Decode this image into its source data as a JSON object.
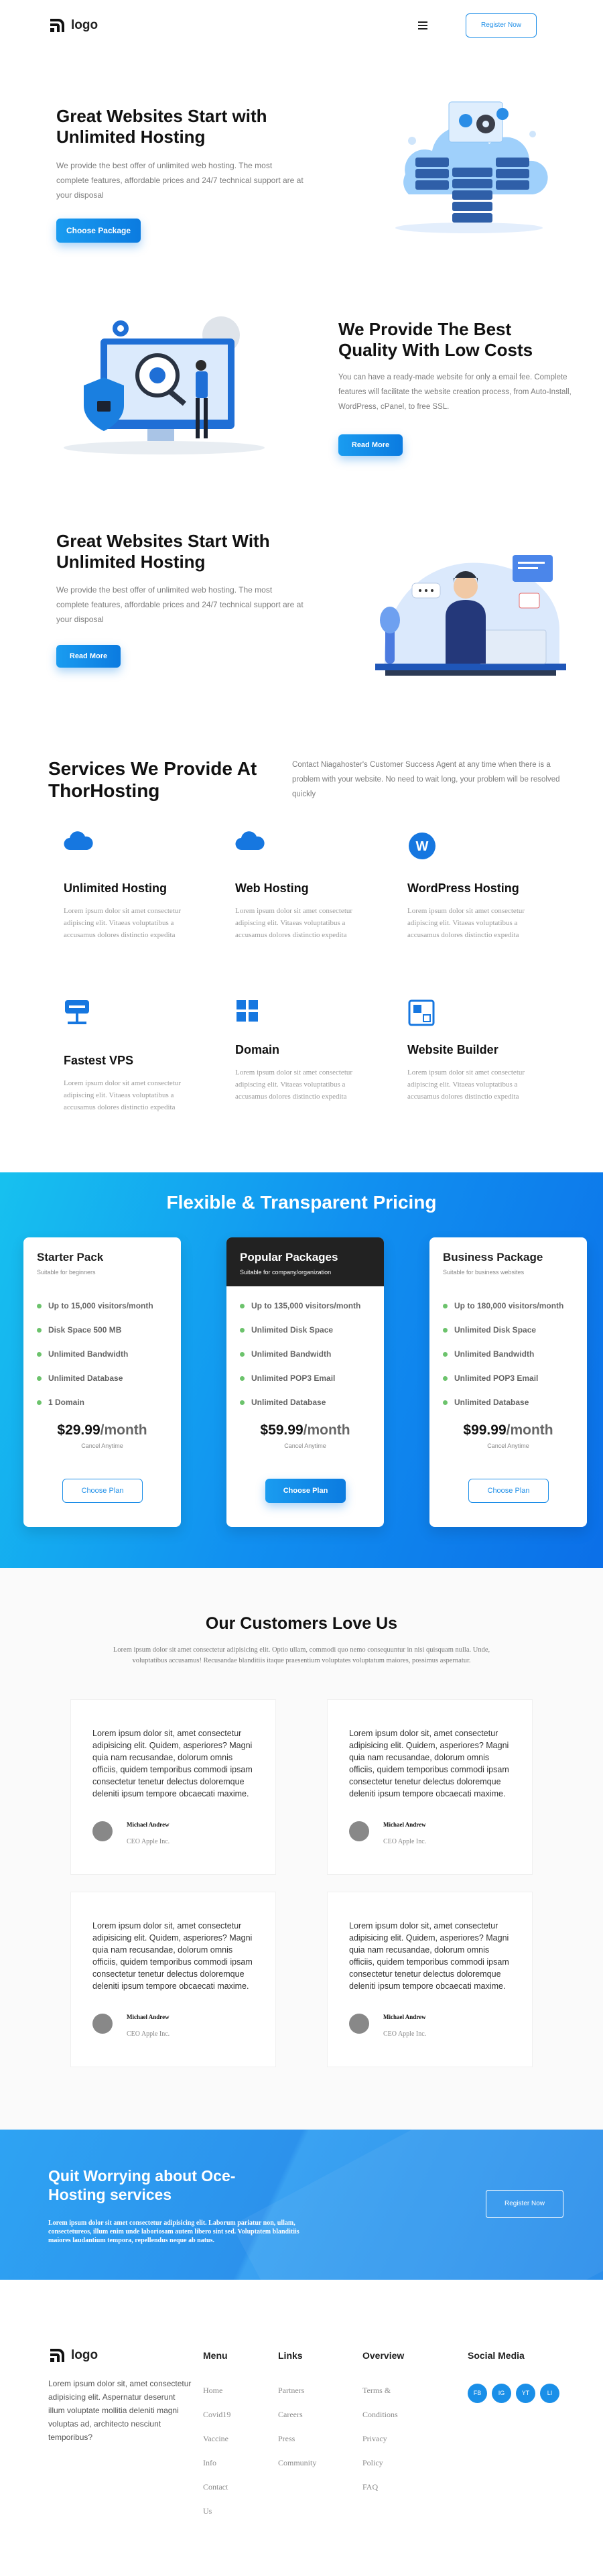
{
  "header": {
    "logo_text": "logo",
    "menu_icon": "hamburger-icon",
    "register_label": "Register Now"
  },
  "hero1": {
    "title": "Great Websites Start with Unlimited Hosting",
    "text": "We provide the best offer of unlimited web hosting. The most complete features, affordable prices and 24/7 technical support are at your disposal",
    "button": "Choose Package"
  },
  "hero2": {
    "title": "We Provide The Best Quality With Low Costs",
    "text": "You can have a ready-made website for only a email fee. Complete features will facilitate the website creation process, from Auto-Install, WordPress, cPanel, to free SSL.",
    "button": "Read More"
  },
  "hero3": {
    "title": "Great Websites Start With Unlimited Hosting",
    "text": "We provide the best offer of unlimited web hosting. The most complete features, affordable prices and 24/7 technical support are at your disposal",
    "button": "Read More"
  },
  "services": {
    "title": "Services We Provide At ThorHosting",
    "intro": "Contact Niagahoster's Customer Success Agent at any time when there is a problem with your website. No need to wait long, your problem will be resolved quickly",
    "items": [
      {
        "title": "Unlimited Hosting",
        "icon": "cloud-icon",
        "text": "Lorem ipsum dolor sit amet consectetur adipiscing elit. Vitaeas voluptatibus a accusamus dolores distinctio expedita"
      },
      {
        "title": "Web Hosting",
        "icon": "cloud-icon",
        "text": "Lorem ipsum dolor sit amet consectetur adipiscing elit. Vitaeas voluptatibus a accusamus dolores distinctio expedita"
      },
      {
        "title": "WordPress Hosting",
        "icon": "wordpress-icon",
        "text": "Lorem ipsum dolor sit amet consectetur adipiscing elit. Vitaeas voluptatibus a accusamus dolores distinctio expedita"
      },
      {
        "title": "Fastest VPS",
        "icon": "server-icon",
        "text": "Lorem ipsum dolor sit amet consectetur adipiscing elit. Vitaeas voluptatibus a accusamus dolores distinctio expedita"
      },
      {
        "title": "Domain",
        "icon": "grid-icon",
        "text": "Lorem ipsum dolor sit amet consectetur adipiscing elit. Vitaeas voluptatibus a accusamus dolores distinctio expedita"
      },
      {
        "title": "Website Builder",
        "icon": "builder-icon",
        "text": "Lorem ipsum dolor sit amet consectetur adipiscing elit. Vitaeas voluptatibus a accusamus dolores distinctio expedita"
      }
    ]
  },
  "pricing": {
    "title": "Flexible & Transparent Pricing",
    "plans": [
      {
        "name": "Starter Pack",
        "subtitle": "Suitable for beginners",
        "features": [
          "Up to 15,000 visitors/month",
          "Disk Space 500 MB",
          "Unlimited Bandwidth",
          "Unlimited Database",
          "1 Domain"
        ],
        "price": "$29.99",
        "period": "/month",
        "cancel": "Cancel Anytime",
        "button": "Choose Plan"
      },
      {
        "name": "Popular Packages",
        "subtitle": "Suitable for company/organization",
        "features": [
          "Up to 135,000 visitors/month",
          "Unlimited Disk Space",
          "Unlimited Bandwidth",
          "Unlimited POP3 Email",
          "Unlimited Database"
        ],
        "price": "$59.99",
        "period": "/month",
        "cancel": "Cancel Anytime",
        "button": "Choose Plan"
      },
      {
        "name": "Business Package",
        "subtitle": "Suitable for business websites",
        "features": [
          "Up to 180,000 visitors/month",
          "Unlimited Disk Space",
          "Unlimited Bandwidth",
          "Unlimited POP3 Email",
          "Unlimited Database"
        ],
        "price": "$99.99",
        "period": "/month",
        "cancel": "Cancel Anytime",
        "button": "Choose Plan"
      }
    ]
  },
  "testimonials": {
    "title": "Our Customers Love Us",
    "intro": "Lorem ipsum dolor sit amet consectetur adipisicing elit. Optio ullam, commodi quo nemo consequuntur in nisi quisquam nulla. Unde, voluptatibus accusamus! Recusandae blanditiis itaque praesentium voluptates voluptatum maiores, possimus aspernatur.",
    "items": [
      {
        "quote": "Lorem ipsum dolor sit, amet consectetur adipisicing elit. Quidem, asperiores? Magni quia nam recusandae, dolorum omnis officiis, quidem temporibus commodi ipsam consectetur tenetur delectus doloremque deleniti ipsum tempore obcaecati maxime.",
        "name": "Michael Andrew",
        "role": "CEO Apple Inc."
      },
      {
        "quote": "Lorem ipsum dolor sit, amet consectetur adipisicing elit. Quidem, asperiores? Magni quia nam recusandae, dolorum omnis officiis, quidem temporibus commodi ipsam consectetur tenetur delectus doloremque deleniti ipsum tempore obcaecati maxime.",
        "name": "Michael Andrew",
        "role": "CEO Apple Inc."
      },
      {
        "quote": "Lorem ipsum dolor sit, amet consectetur adipisicing elit. Quidem, asperiores? Magni quia nam recusandae, dolorum omnis officiis, quidem temporibus commodi ipsam consectetur tenetur delectus doloremque deleniti ipsum tempore obcaecati maxime.",
        "name": "Michael Andrew",
        "role": "CEO Apple Inc."
      },
      {
        "quote": "Lorem ipsum dolor sit, amet consectetur adipisicing elit. Quidem, asperiores? Magni quia nam recusandae, dolorum omnis officiis, quidem temporibus commodi ipsam consectetur tenetur delectus doloremque deleniti ipsum tempore obcaecati maxime.",
        "name": "Michael Andrew",
        "role": "CEO Apple Inc."
      }
    ]
  },
  "cta": {
    "title": "Quit Worrying about Oce-Hosting services",
    "text": "Lorem ipsum dolor sit amet consectetur adipisicing elit. Laborum pariatur non, ullam, consectetureos, illum enim unde laboriosam autem libero sint sed. Voluptatem blanditiis maiores laudantium tempora, repellendus neque ab natus.",
    "button": "Register Now"
  },
  "footer": {
    "logo_text": "logo",
    "about": "Lorem ipsum dolor sit, amet consectetur adipisicing elit. Aspernatur deserunt illum voluptate mollitia deleniti magni voluptas ad, architecto nesciunt temporibus?",
    "menu": {
      "title": "Menu",
      "items": [
        "Home",
        "Covid19",
        "Vaccine",
        "Info",
        "Contact",
        "Us"
      ]
    },
    "links": {
      "title": "Links",
      "items": [
        "Partners",
        "Careers",
        "Press",
        "Community"
      ]
    },
    "overview": {
      "title": "Overview",
      "items": [
        "Terms &",
        "Conditions",
        "Privacy",
        "Policy",
        "FAQ"
      ]
    },
    "social": {
      "title": "Social Media",
      "items": [
        "FB",
        "IG",
        "YT",
        "LI"
      ]
    }
  },
  "colors": {
    "primary": "#1a8fe8",
    "dark_card": "#222222",
    "check": "#6cc36c"
  }
}
